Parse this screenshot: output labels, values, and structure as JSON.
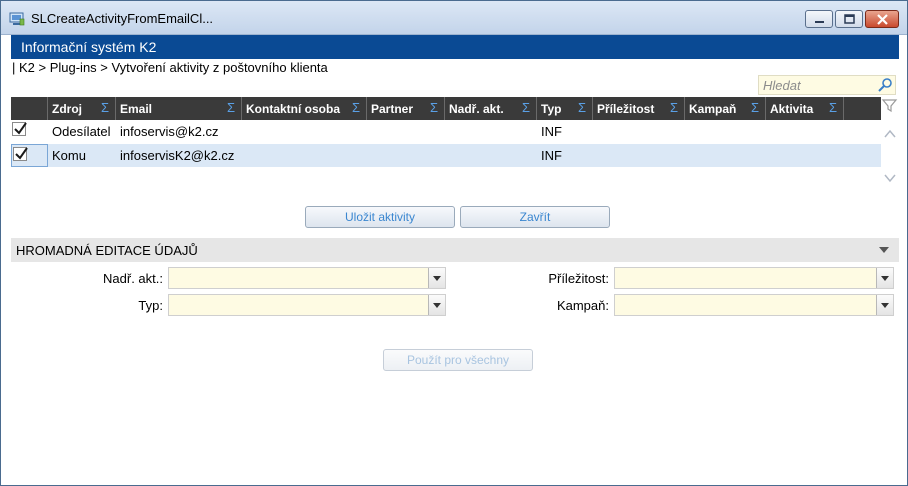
{
  "window": {
    "title": "SLCreateActivityFromEmailCl..."
  },
  "header": {
    "title": "Informační systém K2"
  },
  "breadcrumb": "| K2 > Plug-ins > Vytvoření aktivity z poštovního klienta",
  "search": {
    "placeholder": "Hledat"
  },
  "grid": {
    "columns": [
      "Zdroj",
      "Email",
      "Kontaktní osoba",
      "Partner",
      "Nadř. akt.",
      "Typ",
      "Příležitost",
      "Kampaň",
      "Aktivita"
    ],
    "sum_symbol": "Σ",
    "rows": [
      {
        "checked": true,
        "zdroj": "Odesílatel",
        "email": "infoservis@k2.cz",
        "kontakt": "",
        "partner": "",
        "nadr": "",
        "typ": "INF",
        "prilezitost": "",
        "kampan": "",
        "aktivita": ""
      },
      {
        "checked": true,
        "zdroj": "Komu",
        "email": "infoservisK2@k2.cz",
        "kontakt": "",
        "partner": "",
        "nadr": "",
        "typ": "INF",
        "prilezitost": "",
        "kampan": "",
        "aktivita": ""
      }
    ]
  },
  "actions": {
    "save_label": "Uložit aktivity",
    "close_label": "Zavřít"
  },
  "bulk": {
    "title": "HROMADNÁ EDITACE ÚDAJŮ",
    "nadr_label": "Nadř. akt.:",
    "typ_label": "Typ:",
    "prilezitost_label": "Příležitost:",
    "kampan_label": "Kampaň:",
    "nadr_value": "",
    "typ_value": "",
    "prilezitost_value": "",
    "kampan_value": "",
    "apply_label": "Použít pro všechny"
  },
  "colors": {
    "header_bg": "#0a4a94",
    "grid_head_bg": "#3a3a3a",
    "selected_row": "#dbe8f6",
    "input_bg": "#fefbe3",
    "accent": "#3a86d0"
  }
}
